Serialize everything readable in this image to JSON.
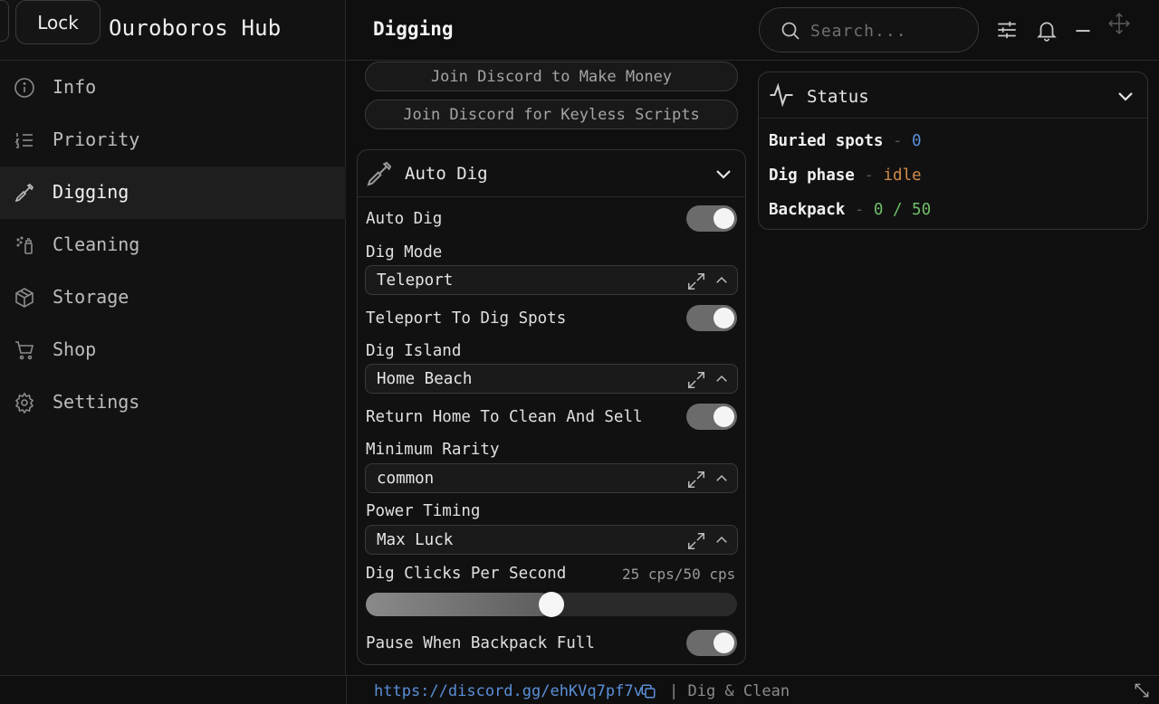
{
  "app": {
    "title": "Ouroboros Hub",
    "lock_label": "Lock"
  },
  "sidebar": {
    "items": [
      {
        "label": "Info",
        "icon": "info-icon"
      },
      {
        "label": "Priority",
        "icon": "list-ordered-icon"
      },
      {
        "label": "Digging",
        "icon": "shovel-icon",
        "active": true
      },
      {
        "label": "Cleaning",
        "icon": "spray-icon"
      },
      {
        "label": "Storage",
        "icon": "box-icon"
      },
      {
        "label": "Shop",
        "icon": "cart-icon"
      },
      {
        "label": "Settings",
        "icon": "gear-icon"
      }
    ]
  },
  "header": {
    "page_title": "Digging",
    "search_placeholder": "Search..."
  },
  "main": {
    "discord_money_label": "Join Discord to Make Money",
    "discord_keyless_label": "Join Discord for Keyless Scripts",
    "section": {
      "title": "Auto Dig",
      "auto_dig_label": "Auto Dig",
      "auto_dig_on": true,
      "dig_mode_label": "Dig Mode",
      "dig_mode_value": "Teleport",
      "teleport_label": "Teleport To Dig Spots",
      "teleport_on": true,
      "dig_island_label": "Dig Island",
      "dig_island_value": "Home Beach",
      "return_home_label": "Return Home To Clean And Sell",
      "return_home_on": true,
      "min_rarity_label": "Minimum Rarity",
      "min_rarity_value": "common",
      "power_timing_label": "Power Timing",
      "power_timing_value": "Max Luck",
      "cps_label": "Dig Clicks Per Second",
      "cps_value_text": "25 cps/50 cps",
      "cps_fraction": 0.5,
      "pause_label": "Pause When Backpack Full",
      "pause_on": true
    }
  },
  "status": {
    "title": "Status",
    "rows": [
      {
        "key": "Buried spots",
        "sep": " - ",
        "value": "0",
        "color": "#5b8fd8"
      },
      {
        "key": "Dig phase",
        "sep": " - ",
        "value": "idle",
        "color": "#d08a4a"
      },
      {
        "key": "Backpack",
        "sep": " - ",
        "value": "0 / 50",
        "color": "#6fbf6a"
      }
    ]
  },
  "footer": {
    "link": "https://discord.gg/ehKVq7pf7v",
    "text": "| Dig & Clean"
  }
}
